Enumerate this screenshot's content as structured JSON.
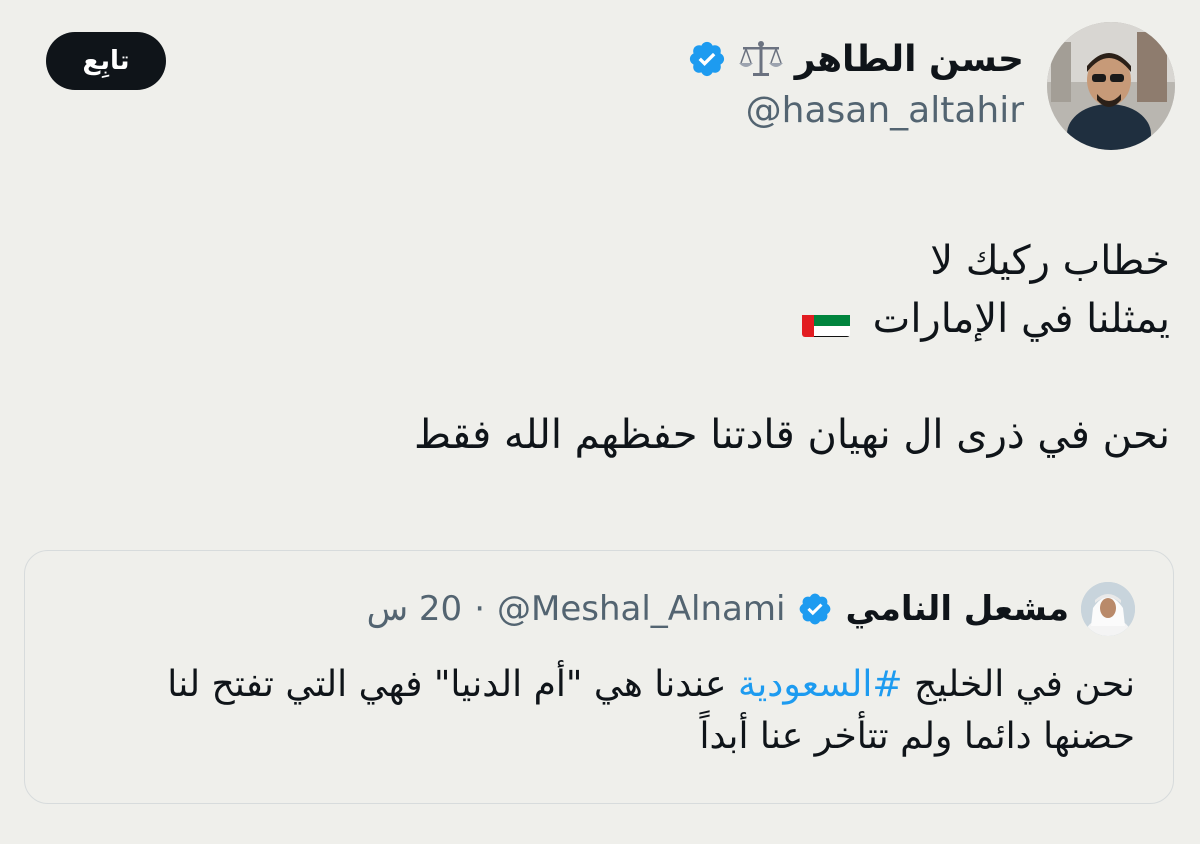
{
  "author": {
    "display_name": "حسن الطاهر",
    "handle": "@hasan_altahir",
    "name_emoji": "scales-icon",
    "verified": true
  },
  "follow_button": {
    "label": "تابِع"
  },
  "tweet": {
    "line1": "خطاب ركيك لا",
    "line2": "يمثلنا في الإمارات",
    "line2_emoji": "uae-flag-icon",
    "line3": "نحن في ذرى ال نهيان قادتنا حفظهم الله فقط"
  },
  "quoted_tweet": {
    "display_name": "مشعل النامي",
    "handle": "@Meshal_Alnami",
    "separator": "·",
    "time": "20 س",
    "verified": true,
    "body_line1_before": "نحن في الخليج ",
    "hashtag": "#السعودية",
    "body_line1_after": " عندنا هي \"أم الدنيا\" فهي التي تفتح لنا",
    "body_line2": "حضنها دائما ولم تتأخر عنا أبداً"
  },
  "colors": {
    "background": "#efefeb",
    "text": "#0f1419",
    "secondary_text": "#536471",
    "verified_blue": "#1d9bf0",
    "hashtag_blue": "#1d9bf0",
    "follow_button_bg": "#0f1419"
  }
}
